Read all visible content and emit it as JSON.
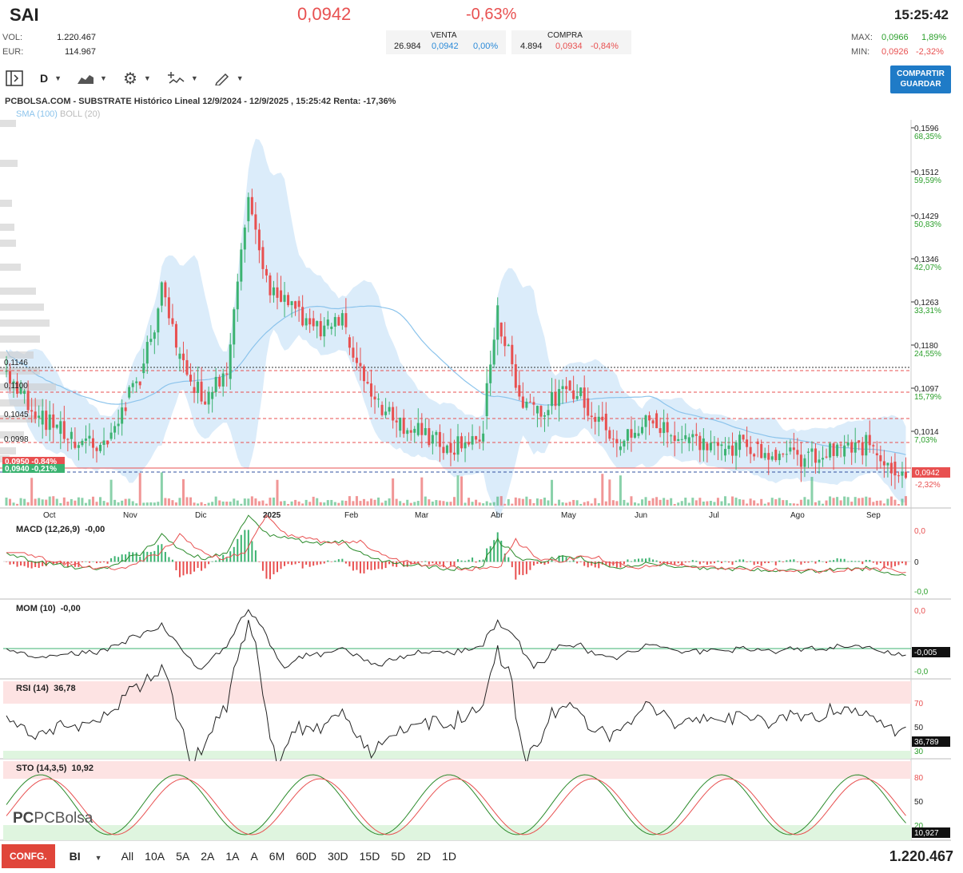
{
  "header": {
    "ticker": "SAI",
    "price": "0,0942",
    "change": "-0,63%",
    "time": "15:25:42"
  },
  "stats": {
    "vol_label": "VOL:",
    "vol": "1.220.467",
    "eur_label": "EUR:",
    "eur": "114.967"
  },
  "orderbook": {
    "venta_label": "VENTA",
    "venta_qty": "26.984",
    "venta_price": "0,0942",
    "venta_pct": "0,00%",
    "compra_label": "COMPRA",
    "compra_qty": "4.894",
    "compra_price": "0,0934",
    "compra_pct": "-0,84%"
  },
  "range": {
    "max_label": "MAX:",
    "max_price": "0,0966",
    "max_pct": "1,89%",
    "min_label": "MIN:",
    "min_price": "0,0926",
    "min_pct": "-2,32%"
  },
  "toolbar": {
    "period": "D",
    "share_line1": "COMPARTIR",
    "share_line2": "GUARDAR",
    "icons": [
      "sidebar-toggle-icon",
      "area-chart-icon",
      "gear-icon",
      "indicators-icon",
      "draw-pencil-icon"
    ]
  },
  "chart": {
    "title": "PCBOLSA.COM - SUBSTRATE Histórico Lineal 12/9/2024 - 12/9/2025 , 15:25:42 Renta: -17,36%",
    "legend_sma": "SMA (100)",
    "legend_boll": "BOLL (20)",
    "right_axis": [
      {
        "price": "0,1596",
        "pct": "68,35%"
      },
      {
        "price": "0,1512",
        "pct": "59,59%"
      },
      {
        "price": "0,1429",
        "pct": "50,83%"
      },
      {
        "price": "0,1346",
        "pct": "42,07%"
      },
      {
        "price": "0,1263",
        "pct": "33,31%"
      },
      {
        "price": "0,1180",
        "pct": "24,55%"
      },
      {
        "price": "0,1097",
        "pct": "15,79%"
      },
      {
        "price": "0,1014",
        "pct": "7,03%"
      }
    ],
    "current_price_tag": "0,0942",
    "current_pct": "-2,32%",
    "left_levels": [
      "0,1146",
      "0,1100",
      "0,1045",
      "0,0998",
      "0,0950 -0,84%",
      "0,0940 -0,21%"
    ],
    "months": [
      "Oct",
      "Nov",
      "Dic",
      "2025",
      "Feb",
      "Mar",
      "Abr",
      "May",
      "Jun",
      "Jul",
      "Ago",
      "Sep"
    ]
  },
  "macd": {
    "label": "MACD (12,26,9)",
    "value": "-0,00",
    "axis_top": "0,0",
    "axis_mid": "0",
    "axis_bot": "-0,0"
  },
  "mom": {
    "label": "MOM (10)",
    "value": "-0,00",
    "axis_top": "0,0",
    "axis_cur": "-0,005",
    "axis_bot": "-0,0"
  },
  "rsi": {
    "label": "RSI (14)",
    "value": "36,78",
    "axis": [
      "70",
      "50",
      "30"
    ],
    "cur": "36,789"
  },
  "sto": {
    "label": "STO (14,3,5)",
    "value": "10,92",
    "axis": [
      "80",
      "50",
      "20"
    ],
    "cur": "10,927",
    "logo": "PCBolsa"
  },
  "footer": {
    "conf": "CONFG.",
    "mode": "BI",
    "periods": [
      "All",
      "10A",
      "5A",
      "2A",
      "1A",
      "A",
      "6M",
      "60D",
      "30D",
      "15D",
      "5D",
      "2D",
      "1D"
    ],
    "total": "1.220.467"
  },
  "colors": {
    "up": "#3cb371",
    "down": "#e85050",
    "band": "#cfe6f8",
    "sma": "#8cc4ec"
  }
}
